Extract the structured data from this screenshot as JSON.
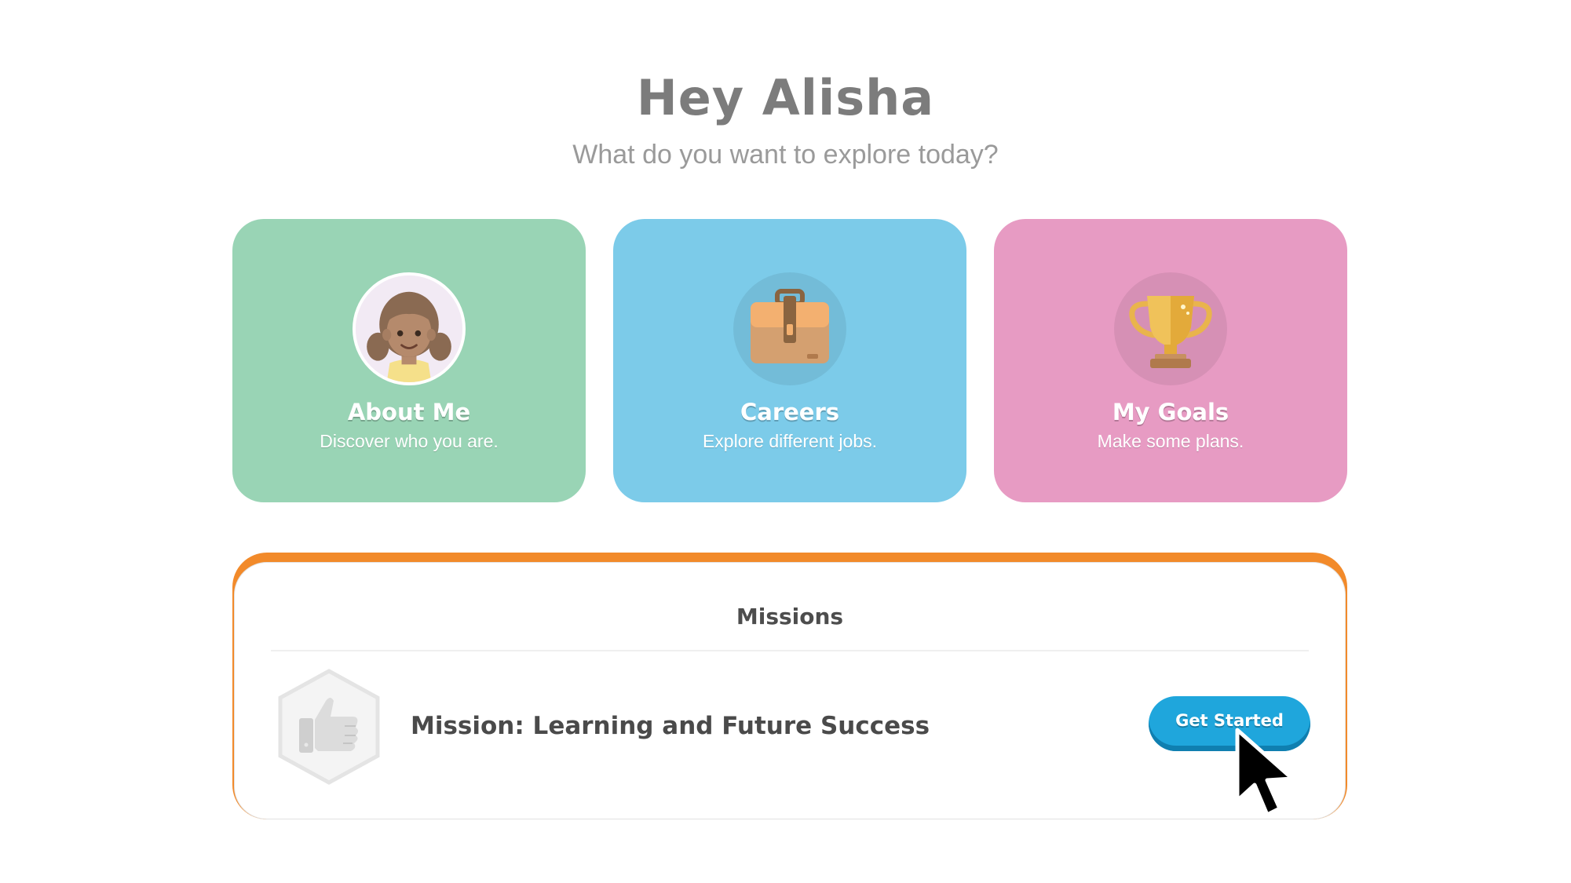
{
  "header": {
    "greeting": "Hey Alisha",
    "subtitle": "What do you want to explore today?"
  },
  "cards": [
    {
      "title": "About Me",
      "description": "Discover who you are.",
      "icon": "girl-avatar-icon",
      "color": "#99d4b5"
    },
    {
      "title": "Careers",
      "description": "Explore different jobs.",
      "icon": "briefcase-icon",
      "color": "#7ccbe9"
    },
    {
      "title": "My Goals",
      "description": "Make some plans.",
      "icon": "trophy-icon",
      "color": "#e79bc3"
    }
  ],
  "missions": {
    "header": "Missions",
    "accent_color": "#f28a2a",
    "items": [
      {
        "title": "Mission: Learning and Future Success",
        "badge_icon": "thumbs-up-icon",
        "button_label": "Get Started",
        "button_color": "#1fa6dc"
      }
    ]
  },
  "cursor": {
    "icon": "mouse-pointer-icon"
  }
}
